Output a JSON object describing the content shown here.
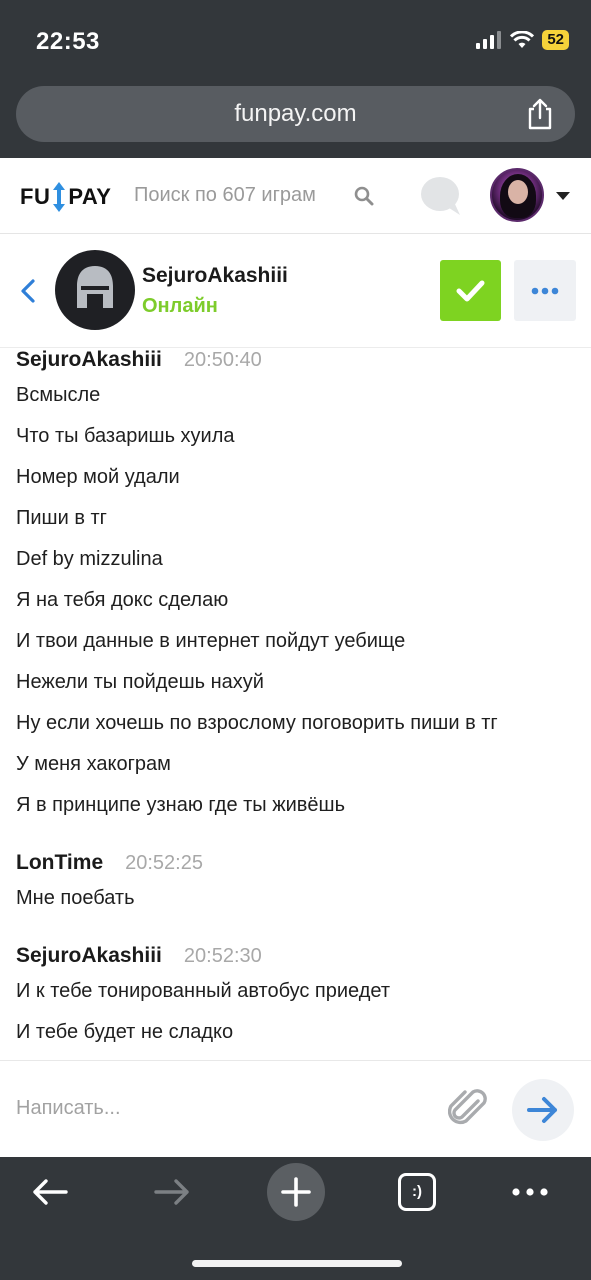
{
  "status_bar": {
    "time": "22:53",
    "battery": "52"
  },
  "browser": {
    "url": "funpay.com"
  },
  "site_header": {
    "logo_left": "FU",
    "logo_right": "PAY",
    "search_placeholder": "Поиск по 607 играм"
  },
  "chat_header": {
    "user_name": "SejuroAkashiii",
    "user_status": "Онлайн"
  },
  "messages": [
    {
      "author": "SejuroAkashiii",
      "time": "20:50:40",
      "lines": [
        "Всмысле",
        "Что ты базаришь хуила",
        "Номер мой удали",
        "Пиши в тг",
        "Def by mizzulina",
        "Я на тебя докс сделаю",
        "И твои данные в интернет пойдут уебище",
        "Нежели ты пойдешь нахуй",
        "Ну если хочешь по взрослому поговорить пиши в тг",
        "У меня хакограм",
        "Я в принципе узнаю где ты живёшь"
      ]
    },
    {
      "author": "LonTime",
      "time": "20:52:25",
      "lines": [
        "Мне поебать"
      ]
    },
    {
      "author": "SejuroAkashiii",
      "time": "20:52:30",
      "lines": [
        "И к тебе тонированный автобус приедет",
        "И тебе будет не сладко"
      ]
    }
  ],
  "composer": {
    "placeholder": "Написать..."
  },
  "toolbar": {
    "tabs_label": ":)"
  },
  "colors": {
    "online": "#7dcc2b",
    "confirm": "#7ed321",
    "accent_blue": "#3d86d7"
  }
}
